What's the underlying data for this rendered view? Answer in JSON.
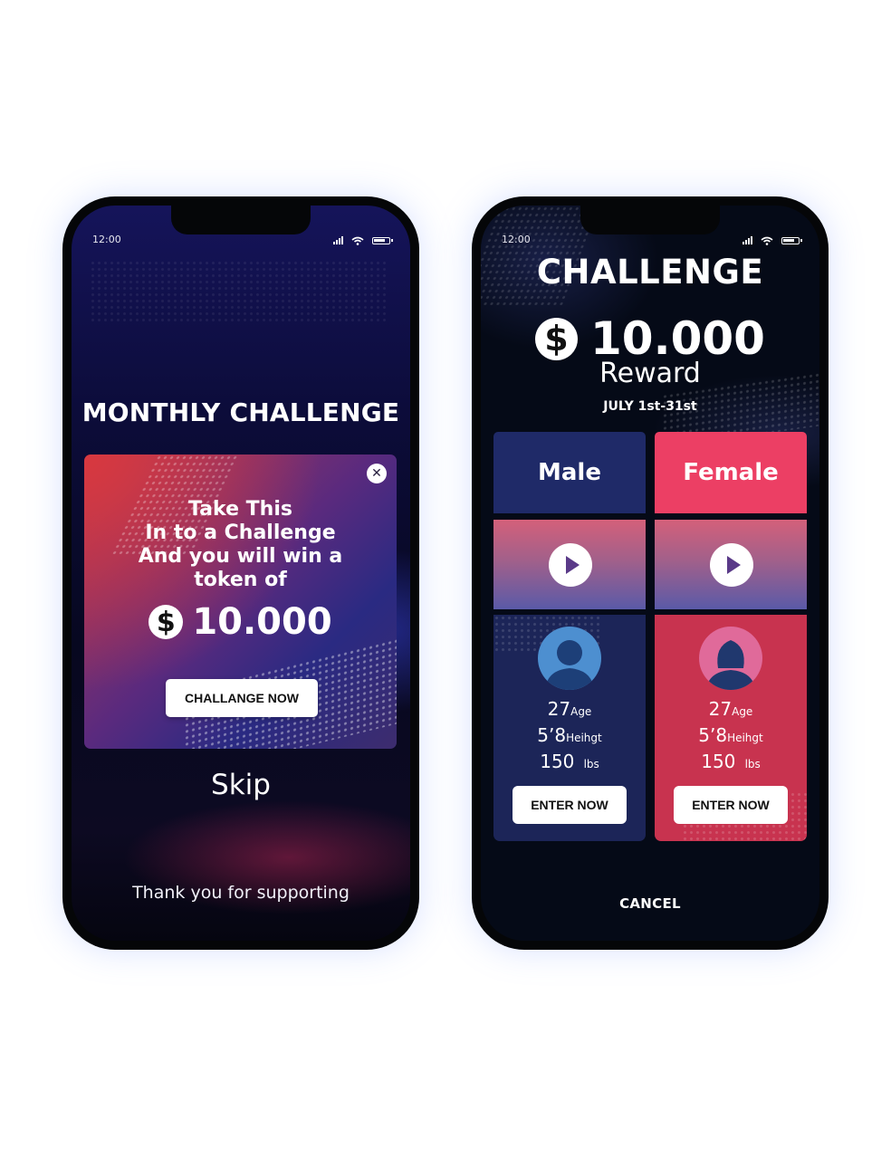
{
  "left_screen": {
    "status_time": "12:00",
    "title": "MONTHLY CHALLENGE",
    "card": {
      "lines": [
        "Take This",
        "In to a Challenge",
        "And you will win a",
        "token of"
      ],
      "currency_symbol": "$",
      "amount": "10.000",
      "button_label": "CHALLANGE NOW"
    },
    "skip_label": "Skip",
    "footer_text": "Thank you for supporting"
  },
  "right_screen": {
    "status_time": "12:00",
    "title": "CHALLENGE",
    "currency_symbol": "$",
    "amount": "10.000",
    "reward_label": "Reward",
    "dates": "JULY 1st-31st",
    "male": {
      "label": "Male",
      "age_value": "27",
      "age_unit": "Age",
      "height_value": "5’8",
      "height_unit": "Heihgt",
      "weight_value": "150",
      "weight_unit": "lbs",
      "button_label": "ENTER NOW"
    },
    "female": {
      "label": "Female",
      "age_value": "27",
      "age_unit": "Age",
      "height_value": "5’8",
      "height_unit": "Heihgt",
      "weight_value": "150",
      "weight_unit": "lbs",
      "button_label": "ENTER NOW"
    },
    "cancel_label": "CANCEL"
  },
  "icons": {
    "close": "close-icon",
    "play": "play-icon",
    "dollar": "dollar-coin-icon",
    "avatar_male": "male-avatar-icon",
    "avatar_female": "female-avatar-icon",
    "signal": "signal-icon",
    "wifi": "wifi-icon",
    "battery": "battery-icon"
  },
  "colors": {
    "male_accent": "#1f2a68",
    "female_accent": "#ec3f64",
    "background_dark": "#050a17"
  }
}
